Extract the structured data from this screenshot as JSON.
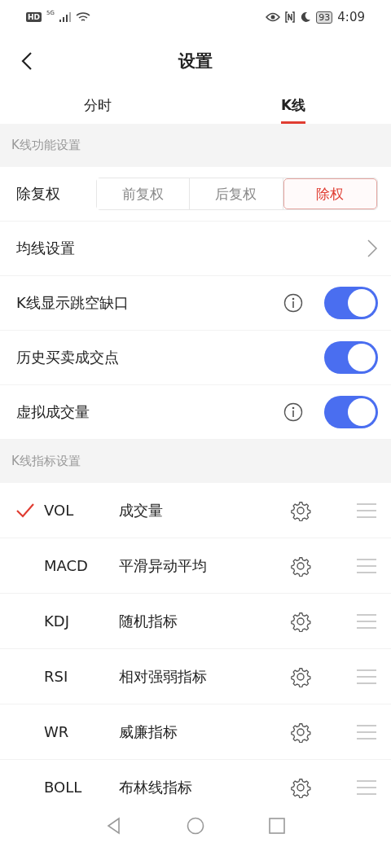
{
  "status_bar": {
    "hd": "HD",
    "network": "5G",
    "battery": "93",
    "time": "4:09"
  },
  "header": {
    "title": "设置"
  },
  "tabs": [
    {
      "label": "分时",
      "selected": false
    },
    {
      "label": "K线",
      "selected": true
    }
  ],
  "sections": [
    {
      "title": "K线功能设置",
      "rows": [
        {
          "kind": "segmented",
          "label": "除复权",
          "options": [
            {
              "label": "前复权",
              "selected": false
            },
            {
              "label": "后复权",
              "selected": false
            },
            {
              "label": "除权",
              "selected": true
            }
          ]
        },
        {
          "kind": "link",
          "label": "均线设置"
        },
        {
          "kind": "toggle",
          "label": "K线显示跳空缺口",
          "info": true,
          "on": true
        },
        {
          "kind": "toggle",
          "label": "历史买卖成交点",
          "info": false,
          "on": true
        },
        {
          "kind": "toggle",
          "label": "虚拟成交量",
          "info": true,
          "on": true
        }
      ]
    },
    {
      "title": "K线指标设置",
      "indicators": [
        {
          "code": "VOL",
          "name": "成交量",
          "checked": true
        },
        {
          "code": "MACD",
          "name": "平滑异动平均",
          "checked": false
        },
        {
          "code": "KDJ",
          "name": "随机指标",
          "checked": false
        },
        {
          "code": "RSI",
          "name": "相对强弱指标",
          "checked": false
        },
        {
          "code": "WR",
          "name": "威廉指标",
          "checked": false
        },
        {
          "code": "BOLL",
          "name": "布林线指标",
          "checked": false
        }
      ]
    }
  ]
}
